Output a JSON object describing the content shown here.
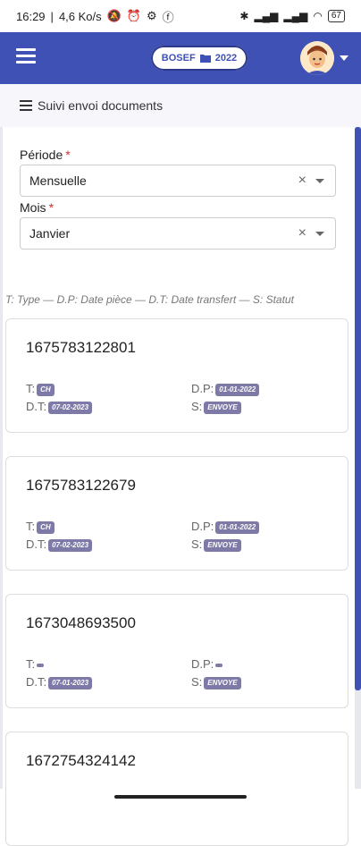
{
  "statusbar": {
    "time": "16:29",
    "net": "4,6 Ko/s",
    "battery": "67"
  },
  "appbar": {
    "pill_org": "BOSEF",
    "pill_year": "2022"
  },
  "breadcrumb": {
    "title": "Suivi envoi documents"
  },
  "filters": {
    "period_label": "Période",
    "period_value": "Mensuelle",
    "month_label": "Mois",
    "month_value": "Janvier",
    "required_mark": "*",
    "clear_glyph": "×"
  },
  "legend": {
    "type_key": "T:",
    "type_label": "Type",
    "dp_key": "D.P:",
    "dp_label": "Date pièce",
    "dt_key": "D.T:",
    "dt_label": "Date transfert",
    "s_key": "S:",
    "s_label": "Statut",
    "separator": "—"
  },
  "card_labels": {
    "type": "T:",
    "dp": "D.P:",
    "dt": "D.T:",
    "status": "S:"
  },
  "cards": [
    {
      "id": "1675783122801",
      "type": "CH",
      "date_piece": "01-01-2022",
      "date_transfert": "07-02-2023",
      "status": "ENVOYE"
    },
    {
      "id": "1675783122679",
      "type": "CH",
      "date_piece": "01-01-2022",
      "date_transfert": "07-02-2023",
      "status": "ENVOYE"
    },
    {
      "id": "1673048693500",
      "type": "",
      "date_piece": "",
      "date_transfert": "07-01-2023",
      "status": "ENVOYE"
    },
    {
      "id": "1672754324142",
      "type": "",
      "date_piece": "",
      "date_transfert": "",
      "status": ""
    }
  ],
  "colors": {
    "primary": "#3f51b5",
    "badge": "#7e7aa8",
    "required": "#d32f2f"
  },
  "icons": {
    "menu": "hamburger-icon",
    "folder": "folder-icon",
    "list": "list-icon",
    "user": "avatar-icon"
  }
}
